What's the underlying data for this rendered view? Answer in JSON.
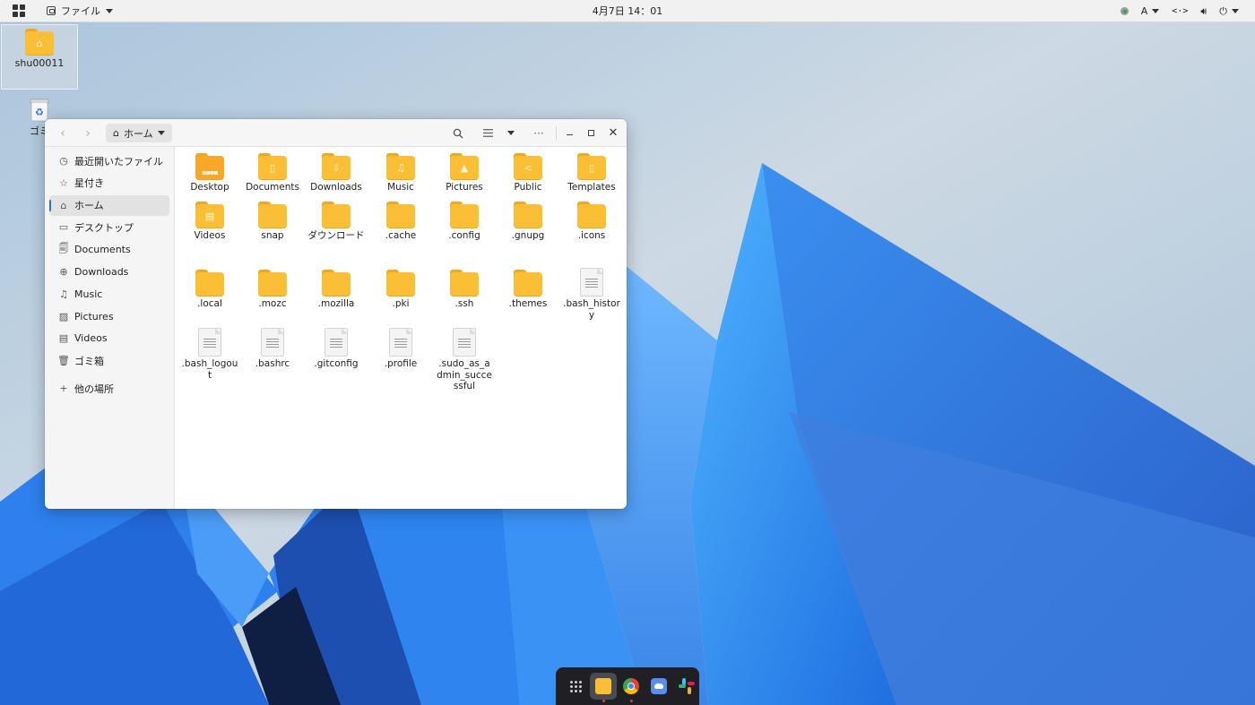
{
  "topbar": {
    "menu_label": "ファイル",
    "clock": "4月7日  14：01",
    "ime_label": "A"
  },
  "desktop": {
    "home_label": "shu00011",
    "trash_label": "ゴミ"
  },
  "window": {
    "path_label": "ホーム"
  },
  "sidebar": {
    "items": [
      {
        "label": "最近開いたファイル",
        "icon": "clock-icon"
      },
      {
        "label": "星付き",
        "icon": "star-icon"
      },
      {
        "label": "ホーム",
        "icon": "home-icon",
        "active": true
      },
      {
        "label": "デスクトップ",
        "icon": "desktop-icon"
      },
      {
        "label": "Documents",
        "icon": "documents-icon"
      },
      {
        "label": "Downloads",
        "icon": "download-icon"
      },
      {
        "label": "Music",
        "icon": "music-icon"
      },
      {
        "label": "Pictures",
        "icon": "pictures-icon"
      },
      {
        "label": "Videos",
        "icon": "videos-icon"
      },
      {
        "label": "ゴミ箱",
        "icon": "trash-icon"
      }
    ],
    "other_locations": "他の場所"
  },
  "files": [
    {
      "name": "Desktop",
      "type": "folder"
    },
    {
      "name": "Documents",
      "type": "folder"
    },
    {
      "name": "Downloads",
      "type": "folder"
    },
    {
      "name": "Music",
      "type": "folder"
    },
    {
      "name": "Pictures",
      "type": "folder"
    },
    {
      "name": "Public",
      "type": "folder"
    },
    {
      "name": "Templates",
      "type": "folder"
    },
    {
      "name": "Videos",
      "type": "folder"
    },
    {
      "name": "snap",
      "type": "folder"
    },
    {
      "name": "ダウンロード",
      "type": "folder"
    },
    {
      "name": ".cache",
      "type": "folder"
    },
    {
      "name": ".config",
      "type": "folder"
    },
    {
      "name": ".gnupg",
      "type": "folder"
    },
    {
      "name": ".icons",
      "type": "folder"
    },
    {
      "name": ".local",
      "type": "folder"
    },
    {
      "name": ".mozc",
      "type": "folder"
    },
    {
      "name": ".mozilla",
      "type": "folder"
    },
    {
      "name": ".pki",
      "type": "folder"
    },
    {
      "name": ".ssh",
      "type": "folder"
    },
    {
      "name": ".themes",
      "type": "folder"
    },
    {
      "name": ".bash_history",
      "type": "file"
    },
    {
      "name": ".bash_logout",
      "type": "file"
    },
    {
      "name": ".bashrc",
      "type": "file"
    },
    {
      "name": ".gitconfig",
      "type": "file"
    },
    {
      "name": ".profile",
      "type": "file"
    },
    {
      "name": ".sudo_as_admin_successful",
      "type": "file"
    }
  ],
  "colors": {
    "folder": "#fbbf36",
    "accent": "#2f6fd8",
    "dock_bg": "#1f1f24"
  }
}
